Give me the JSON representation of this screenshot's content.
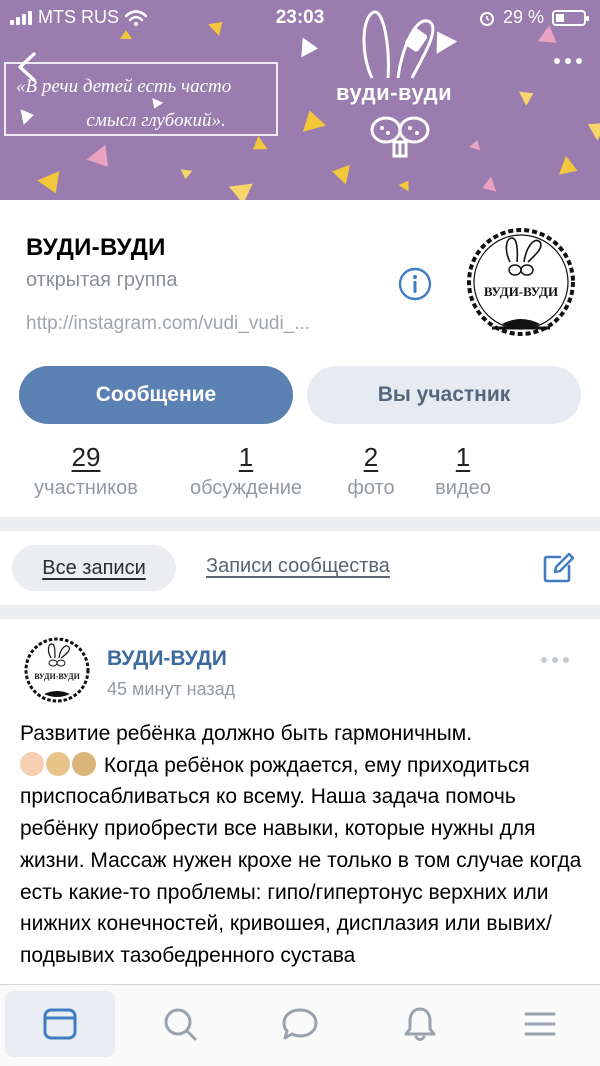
{
  "status_bar": {
    "carrier": "MTS RUS",
    "time": "23:03",
    "battery": "29 %",
    "battery_level": 0.29
  },
  "cover": {
    "quote_line1": "«В речи детей есть часто",
    "quote_line2": "смысл глубокий».",
    "logo_text": "вуди-вуди",
    "color": "#9a7cae"
  },
  "group": {
    "name": "ВУДИ-ВУДИ",
    "type": "открытая группа",
    "link": "http://instagram.com/vudi_vudi_...",
    "avatar_text": "ВУДИ-ВУДИ"
  },
  "actions": {
    "message": "Сообщение",
    "member": "Вы участник"
  },
  "counters": [
    {
      "value": "29",
      "label": "участников"
    },
    {
      "value": "1",
      "label": "обсуждение"
    },
    {
      "value": "2",
      "label": "фото"
    },
    {
      "value": "1",
      "label": "видео"
    }
  ],
  "filters": {
    "all": "Все записи",
    "community": "Записи сообщества"
  },
  "post": {
    "author": "ВУДИ-ВУДИ",
    "time": "45 минут назад",
    "avatar_text": "ВУДИ-ВУДИ",
    "line1": "Развитие ребёнка должно быть гармоничным.",
    "emojis": [
      "baby-emoji",
      "girl-emoji",
      "boy-emoji"
    ],
    "line2": " Когда ребёнок рождается, ему приходиться приспосабливаться ко всему. Наша задача помочь ребёнку приобрести все навыки, которые нужны для жизни. Массаж нужен крохе не только в том случае когда есть какие-то проблемы: гипо/гипертонус верхних или нижних конечностей, кривошея, дисплазия или вывих/подвывих тазобедренного сустава"
  },
  "tabs": [
    {
      "icon": "news-icon",
      "active": true
    },
    {
      "icon": "search-icon",
      "active": false
    },
    {
      "icon": "messages-icon",
      "active": false
    },
    {
      "icon": "notifications-icon",
      "active": false
    },
    {
      "icon": "menu-icon",
      "active": false
    }
  ],
  "colors": {
    "accent": "#5b80b2",
    "link": "#3c6b9f",
    "secondary_button": "#e5ebf1",
    "muted": "#939aa1"
  }
}
